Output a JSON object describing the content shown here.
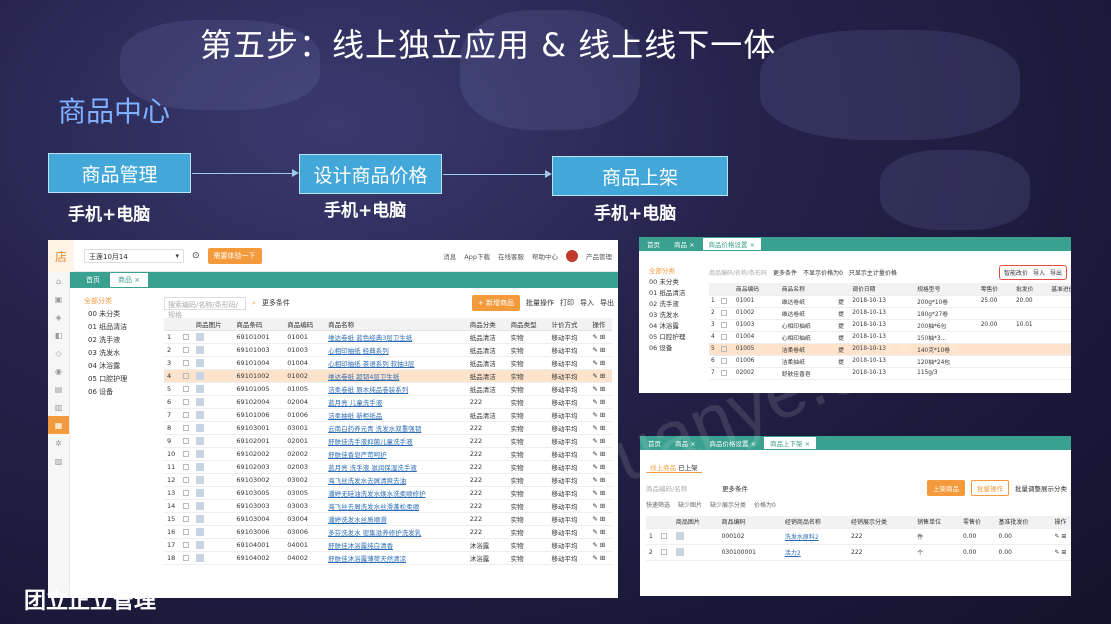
{
  "slide": {
    "title": "第五步：线上独立应用 & 线上线下一体",
    "section": "商品中心",
    "footer": "团立正立管理",
    "watermark": "uanye.com"
  },
  "flow": [
    {
      "label": "商品管理",
      "sub": "手机+电脑"
    },
    {
      "label": "设计商品价格",
      "sub": "手机+电脑"
    },
    {
      "label": "商品上架",
      "sub": "手机+电脑"
    }
  ],
  "app1": {
    "logo": "店",
    "store_select": "王莲10月14",
    "trial_button": "需要体验一下",
    "top_links": [
      "消息",
      "App下载",
      "在线客服",
      "帮助中心",
      "产品管理"
    ],
    "tabs": [
      "首页",
      "商品 ×"
    ],
    "categories": [
      "全部分类",
      "00 未分类",
      "01 纸品清洁",
      "02 洗手液",
      "03 洗发水",
      "04 沐浴露",
      "05 口腔护理",
      "06 设备"
    ],
    "search_placeholder": "搜索编码/名称/条形码/规格",
    "more_filter": "更多条件",
    "add_button": "+ 新增商品",
    "batch": "批量操作",
    "print": "打印",
    "import": "导入",
    "export": "导出",
    "columns": [
      "",
      "",
      "商品图片",
      "商品条码",
      "商品编码",
      "商品名称",
      "商品分类",
      "商品类型",
      "计价方式",
      "操作"
    ],
    "rows": [
      [
        "1",
        "69101001",
        "01001",
        "维达卷纸 蓝色经典3层卫生纸",
        "纸品清洁",
        "实物",
        "移动平均"
      ],
      [
        "2",
        "69101003",
        "01003",
        "心相印抽纸 经典系列",
        "纸品清洁",
        "实物",
        "移动平均"
      ],
      [
        "3",
        "69101004",
        "01004",
        "心相印抽纸 茶语系列 软抽3层",
        "纸品清洁",
        "实物",
        "移动平均"
      ],
      [
        "4",
        "69101002",
        "01002",
        "维达卷纸 超韧4层卫生纸",
        "纸品清洁",
        "实物",
        "移动平均"
      ],
      [
        "5",
        "69101005",
        "01005",
        "洁柔卷纸 原木纯品卷装系列",
        "纸品清洁",
        "实物",
        "移动平均"
      ],
      [
        "6",
        "69102004",
        "02004",
        "蓝月亮 儿童洗手液",
        "222",
        "实物",
        "移动平均"
      ],
      [
        "7",
        "69101006",
        "01006",
        "洁柔抽纸 新柜纸品",
        "纸品清洁",
        "实物",
        "移动平均"
      ],
      [
        "8",
        "69103001",
        "03001",
        "云南白药养元青 洗发水双重强韧",
        "222",
        "实物",
        "移动平均"
      ],
      [
        "9",
        "69102001",
        "02001",
        "舒肤佳洗手液抑菌儿童洗手液",
        "222",
        "实物",
        "移动平均"
      ],
      [
        "10",
        "69102002",
        "02002",
        "舒肤佳香皂严苛呵护",
        "222",
        "实物",
        "移动平均"
      ],
      [
        "11",
        "69102003",
        "02003",
        "蓝月亮 洗手液 滋润保湿洗手液",
        "222",
        "实物",
        "移动平均"
      ],
      [
        "12",
        "69103002",
        "03002",
        "海飞丝洗发水去屑清爽去油",
        "222",
        "实物",
        "移动平均"
      ],
      [
        "13",
        "69103005",
        "03005",
        "潘婷无硅油洗发水焕水洗柔顺修护",
        "222",
        "实物",
        "移动平均"
      ],
      [
        "14",
        "69103003",
        "03003",
        "海飞丝去屑洗发水丝滑蓬松柔顺",
        "222",
        "实物",
        "移动平均"
      ],
      [
        "15",
        "69103004",
        "03004",
        "潘婷洗发水丝质顺滑",
        "222",
        "实物",
        "移动平均"
      ],
      [
        "16",
        "69103006",
        "03006",
        "多芬洗发水 密集滋养修护洗发乳",
        "222",
        "实物",
        "移动平均"
      ],
      [
        "17",
        "69104001",
        "04001",
        "舒肤佳沐浴露纯白清香",
        "沐浴露",
        "实物",
        "移动平均"
      ],
      [
        "18",
        "69104002",
        "04002",
        "舒肤佳沐浴露薄荷天然清凉",
        "沐浴露",
        "实物",
        "移动平均"
      ]
    ]
  },
  "app2": {
    "tabs": [
      "首页",
      "商品 ×",
      "商品价格设置 ×"
    ],
    "categories": [
      "全部分类",
      "00 未分类",
      "01 纸品清洁",
      "02 洗手液",
      "03 洗发水",
      "04 沐浴露",
      "05 口腔护理",
      "06 设备"
    ],
    "search_placeholder": "商品编码/名称/条形码",
    "more_filter": "更多条件",
    "opt1": "不显示价格为0",
    "opt2": "只显示主计量价格",
    "tools": [
      "智能改价",
      "导入",
      "导出"
    ],
    "columns": [
      "",
      "",
      "商品编码",
      "商品名称",
      "",
      "调价日期",
      "规格型号",
      "零售价",
      "批发价",
      "基准进价",
      "参考成本"
    ],
    "rows": [
      [
        "1",
        "01001",
        "维达卷纸",
        "提",
        "2018-10-13",
        "200g*10卷",
        "25.00",
        "20.00",
        "",
        "15."
      ],
      [
        "2",
        "01002",
        "维达卷纸",
        "提",
        "2018-10-13",
        "180g*27卷",
        "",
        "",
        "",
        "11."
      ],
      [
        "3",
        "01003",
        "心相印抽纸",
        "提",
        "2018-10-13",
        "200抽*6包",
        "20.00",
        "10.01",
        "",
        "11."
      ],
      [
        "4",
        "01004",
        "心相印抽纸",
        "提",
        "2018-10-13",
        "150抽*3...",
        "",
        "",
        "",
        "11."
      ],
      [
        "5",
        "01005",
        "洁柔卷纸",
        "提",
        "2018-10-13",
        "140克*10卷",
        "",
        "",
        "",
        "11."
      ],
      [
        "6",
        "01006",
        "洁柔抽纸",
        "提",
        "2018-10-13",
        "120抽*24包",
        "",
        "",
        "",
        "11."
      ],
      [
        "7",
        "02002",
        "舒肤佳香皂",
        "",
        "2018-10-13",
        "115g/3",
        "",
        "",
        "",
        "7."
      ]
    ]
  },
  "app3": {
    "tabs": [
      "首页",
      "商品 ×",
      "商品价格设置 ×",
      "商品上下架 ×"
    ],
    "subtabs": [
      "线上商品",
      "已上架"
    ],
    "search_placeholder": "商品编码/名称",
    "more_filter": "更多条件",
    "btn1": "上架商品",
    "btn2": "批量操作",
    "btn3": "批量调整展示分类",
    "filters": [
      "快速筛选",
      "缺少图片",
      "缺少展示分类",
      "价格为0"
    ],
    "columns": [
      "",
      "",
      "商品图片",
      "商品编码",
      "经销商品名称",
      "经销展示分类",
      "销售单位",
      "零售价",
      "基准批发价",
      "操作"
    ],
    "rows": [
      [
        "1",
        "000102",
        "洗发水原料2",
        "222",
        "件",
        "0.00",
        "0.00"
      ],
      [
        "2",
        "030100001",
        "活力2",
        "222",
        "个",
        "0.00",
        "0.00"
      ]
    ]
  }
}
